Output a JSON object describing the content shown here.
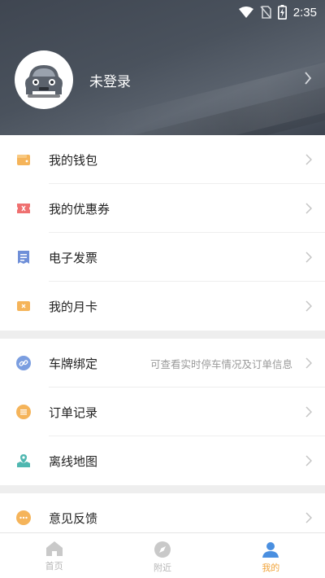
{
  "status_bar": {
    "time": "2:35"
  },
  "profile": {
    "login_text": "未登录"
  },
  "menu_group1": [
    {
      "label": "我的钱包",
      "icon": "wallet-icon",
      "color": "#f5b45a"
    },
    {
      "label": "我的优惠券",
      "icon": "coupon-icon",
      "color": "#ef7070"
    },
    {
      "label": "电子发票",
      "icon": "invoice-icon",
      "color": "#6f8fd8"
    },
    {
      "label": "我的月卡",
      "icon": "card-icon",
      "color": "#f5b45a"
    }
  ],
  "menu_group2": [
    {
      "label": "车牌绑定",
      "hint": "可查看实时停车情况及订单信息",
      "icon": "link-icon",
      "color": "#7b9ee0"
    },
    {
      "label": "订单记录",
      "icon": "list-icon",
      "color": "#f5b45a"
    },
    {
      "label": "离线地图",
      "icon": "map-icon",
      "color": "#4fb7b0"
    }
  ],
  "menu_group3": [
    {
      "label": "意见反馈",
      "icon": "feedback-icon",
      "color": "#f5b45a"
    }
  ],
  "tabs": [
    {
      "label": "首页",
      "icon": "home-icon"
    },
    {
      "label": "附近",
      "icon": "compass-icon"
    },
    {
      "label": "我的",
      "icon": "user-icon",
      "active": true
    }
  ],
  "colors": {
    "accent": "#f1a43b",
    "header_bg": "#464d58"
  }
}
